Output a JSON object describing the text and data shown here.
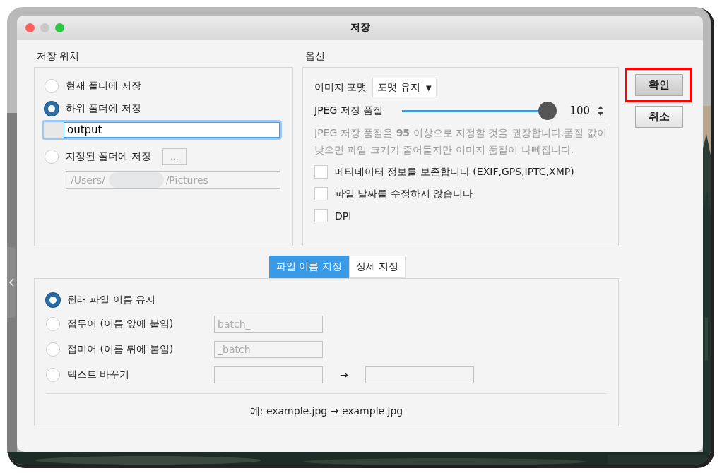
{
  "window": {
    "title": "저장"
  },
  "location": {
    "title": "저장 위치",
    "options": [
      {
        "kind": "plain",
        "label": "현재 폴더에 저장",
        "selected": false
      },
      {
        "kind": "subfolder",
        "label": "하위 폴더에 저장",
        "selected": true,
        "value": "output"
      },
      {
        "kind": "folder",
        "label": "지정된 폴더에 저장",
        "selected": false,
        "browse": "...",
        "path_start": "/Users/",
        "path_end": "/Pictures"
      }
    ]
  },
  "options": {
    "title": "옵션",
    "format": {
      "label": "이미지 포맷",
      "value": "포맷 유지",
      "caret": "▼"
    },
    "quality": {
      "label": "JPEG 저장 품질",
      "level": 1,
      "value": "100"
    },
    "hint": "JPEG 저장 품질을 **95** 이상으로 지정할 것을 권장합니다.품질 값이 낮으면 파일 크기가 줄어들지만 이미지 품질이 나빠집니다.",
    "checks": [
      {
        "label": "메타데이터 정보를 보존합니다 (EXIF,GPS,IPTC,XMP)",
        "checked": false
      },
      {
        "label": "파일 날짜를 수정하지 않습니다",
        "checked": false
      },
      {
        "label": "DPI",
        "checked": false
      }
    ]
  },
  "tabs": [
    {
      "label": "파일 이름 지정",
      "selected": true
    },
    {
      "label": "상세 지정",
      "selected": false
    }
  ],
  "naming": {
    "options": [
      {
        "kind": "plain",
        "label": "원래 파일 이름 유지",
        "selected": true
      },
      {
        "kind": "field",
        "label": "접두어 (이름 앞에 붙임)",
        "selected": false,
        "placeholder": "batch_"
      },
      {
        "kind": "field",
        "label": "접미어 (이름 뒤에 붙임)",
        "selected": false,
        "placeholder": "_batch"
      },
      {
        "kind": "replace",
        "label": "텍스트 바꾸기",
        "selected": false,
        "arrow": "→"
      }
    ],
    "example": "예: example.jpg → example.jpg"
  },
  "buttons": [
    {
      "label": "확인",
      "highlighted": true
    },
    {
      "label": "취소",
      "highlighted": false
    }
  ]
}
